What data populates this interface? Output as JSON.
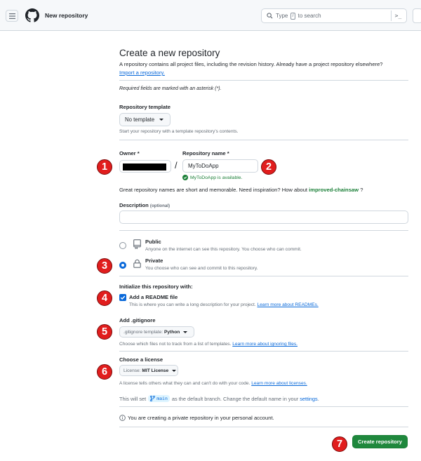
{
  "header": {
    "page_title": "New repository",
    "search_placeholder_pre": "Type",
    "search_key": "/",
    "search_placeholder_post": "to search",
    "command_glyph": ">_"
  },
  "form": {
    "title": "Create a new repository",
    "subtitle": "A repository contains all project files, including the revision history. Already have a project repository elsewhere?",
    "import_link": "Import a repository.",
    "required_note": "Required fields are marked with an asterisk (*).",
    "template": {
      "label": "Repository template",
      "value": "No template",
      "note": "Start your repository with a template repository's contents."
    },
    "owner": {
      "label": "Owner *"
    },
    "separator": "/",
    "repo_name": {
      "label": "Repository name *",
      "value": "MyToDoApp",
      "availability": "MyToDoApp is available."
    },
    "inspiration": {
      "text": "Great repository names are short and memorable. Need inspiration? How about",
      "suggestion": "improved-chainsaw",
      "end": "?"
    },
    "description": {
      "label": "Description",
      "optional": "(optional)",
      "value": ""
    },
    "visibility": {
      "public": {
        "label": "Public",
        "note": "Anyone on the internet can see this repository. You choose who can commit.",
        "selected": false
      },
      "private": {
        "label": "Private",
        "note": "You choose who can see and commit to this repository.",
        "selected": true
      }
    },
    "init": {
      "heading": "Initialize this repository with:",
      "readme": {
        "label": "Add a README file",
        "note": "This is where you can write a long description for your project.",
        "link": "Learn more about READMEs.",
        "checked": true
      }
    },
    "gitignore": {
      "label": "Add .gitignore",
      "prefix": ".gitignore template:",
      "value": "Python",
      "note": "Choose which files not to track from a list of templates.",
      "link": "Learn more about ignoring files."
    },
    "license": {
      "label": "Choose a license",
      "prefix": "License:",
      "value": "MIT License",
      "note": "A license tells others what they can and can't do with your code.",
      "link": "Learn more about licenses."
    },
    "branch": {
      "pre": "This will set",
      "name": "main",
      "post": "as the default branch. Change the default name in your",
      "link": "settings",
      "end": "."
    },
    "info": "You are creating a private repository in your personal account.",
    "submit": "Create repository"
  },
  "annotations": [
    "1",
    "2",
    "3",
    "4",
    "5",
    "6",
    "7"
  ],
  "colors": {
    "accent": "#0969da",
    "success": "#1f883d",
    "badge": "#e11d1d"
  }
}
